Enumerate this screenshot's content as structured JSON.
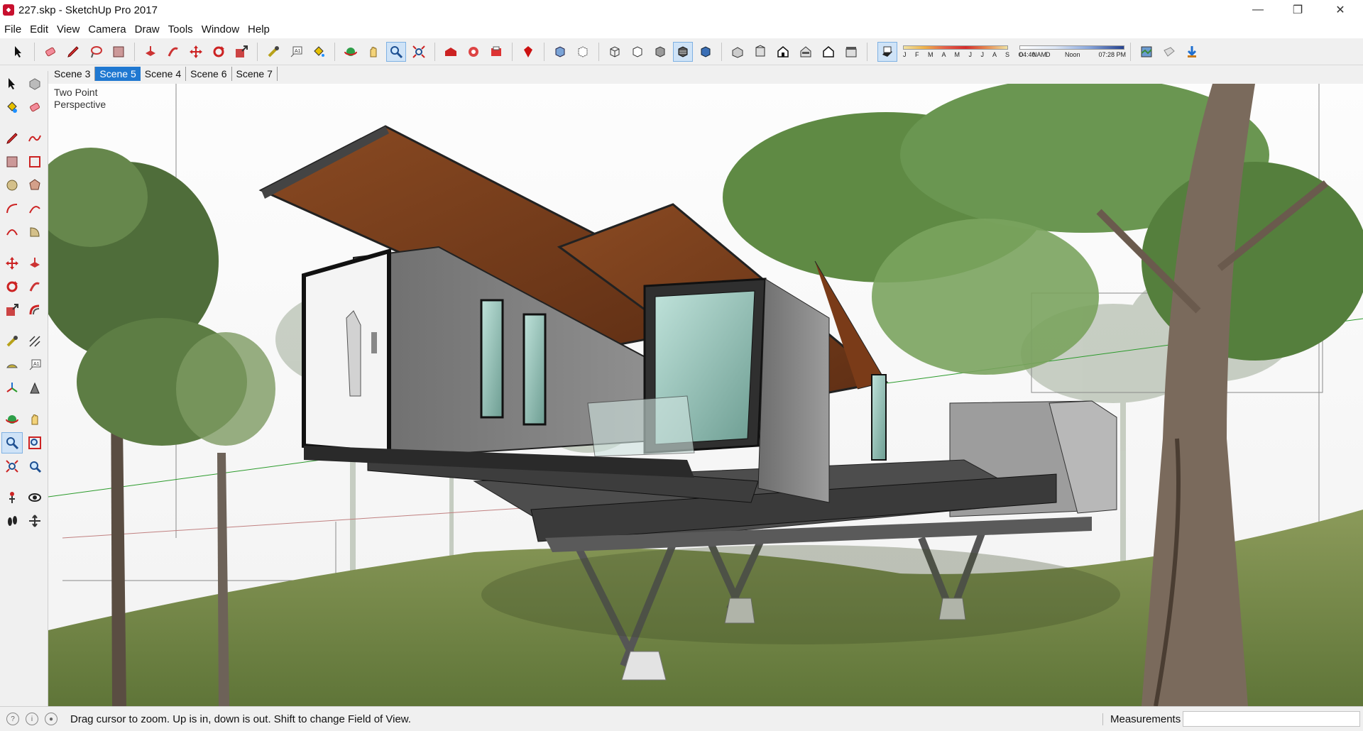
{
  "window": {
    "title": "227.skp - SketchUp Pro 2017",
    "minimize": "—",
    "maximize": "❐",
    "close": "✕"
  },
  "menu": [
    "File",
    "Edit",
    "View",
    "Camera",
    "Draw",
    "Tools",
    "Window",
    "Help"
  ],
  "shadow_settings": {
    "months": "J F M A M J J A S O N D",
    "time_start": "04:40 AM",
    "time_mid": "Noon",
    "time_end": "07:28 PM"
  },
  "scenes": [
    "Scene 3",
    "Scene 5",
    "Scene 4",
    "Scene 6",
    "Scene 7"
  ],
  "active_scene": "Scene 5",
  "viewport": {
    "camera_label_1": "Two Point",
    "camera_label_2": "Perspective"
  },
  "status": {
    "message": "Drag cursor to zoom.  Up is in, down is out. Shift to change Field of View.",
    "measurements_label": "Measurements",
    "measurements_value": ""
  },
  "icons": {
    "toolbar": [
      "select-icon",
      "eraser-icon",
      "pencil-icon",
      "lasso-icon",
      "paint-bucket-icon",
      "push-pull-icon",
      "follow-me-icon",
      "move-icon",
      "rotate-icon",
      "scale-icon",
      "tape-measure-icon",
      "text-icon",
      "paint-icon",
      "orbit-icon",
      "pan-icon",
      "zoom-icon",
      "zoom-extents-icon",
      "warehouse-icon",
      "extension-icon",
      "share-icon",
      "ruby-icon",
      "xray-icon",
      "back-edges-icon",
      "wireframe-icon",
      "hidden-line-icon",
      "shaded-icon",
      "shaded-texture-icon",
      "monochrome-icon",
      "iso-icon",
      "top-icon",
      "front-icon",
      "right-icon",
      "back-icon",
      "left-icon",
      "shadows-icon",
      "fog-icon",
      "section-icon",
      "geo-icon"
    ]
  }
}
